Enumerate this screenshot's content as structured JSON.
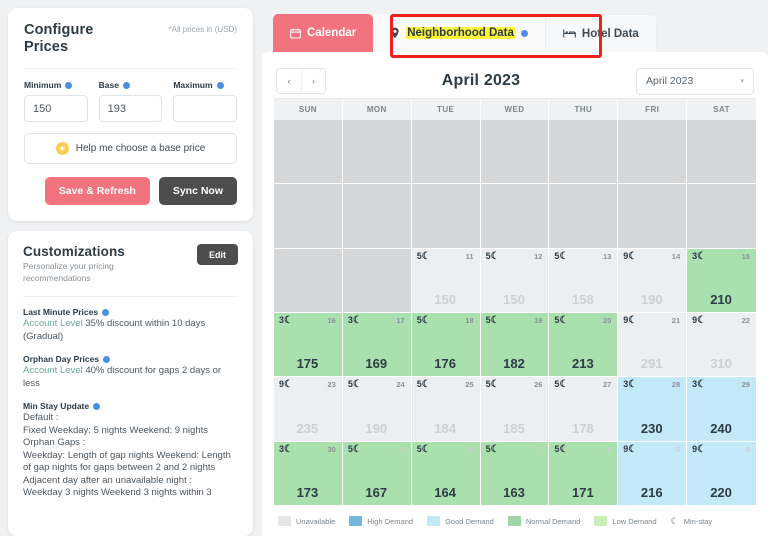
{
  "sidebar": {
    "configure": {
      "title": "Configure Prices",
      "note": "*All prices in (USD)",
      "minimum_label": "Minimum",
      "minimum_value": "150",
      "base_label": "Base",
      "base_value": "193",
      "maximum_label": "Maximum",
      "maximum_value": "",
      "maximum_placeholder": "",
      "help_label": "Help me choose a base price",
      "save_label": "Save & Refresh",
      "sync_label": "Sync Now"
    },
    "customizations": {
      "title": "Customizations",
      "subtitle": "Personalize your pricing recommendations",
      "edit_label": "Edit",
      "rules": [
        {
          "heading": "Last Minute Prices",
          "scope": "Account Level",
          "body": "35% discount within 10 days (Gradual)"
        },
        {
          "heading": "Orphan Day Prices",
          "scope": "Account Level",
          "body": "40% discount for gaps 2 days or less"
        }
      ],
      "min_stay": {
        "heading": "Min Stay Update",
        "default_label": "Default :",
        "default_value": "Fixed Weekday: 5 nights Weekend: 9 nights",
        "orphan_label": "Orphan Gaps :",
        "orphan_value": "Weekday: Length of gap nights Weekend: Length of gap nights for gaps between 2 and 2 nights",
        "adjacent_label": "Adjacent day after an unavailable night :",
        "adjacent_value": "Weekday 3 nights Weekend 3 nights within 3"
      }
    }
  },
  "tabs": [
    {
      "label": "Calendar",
      "icon": "calendar-icon",
      "state": "active"
    },
    {
      "label": "Neighborhood Data",
      "icon": "location-pin-icon",
      "state": "highlighted",
      "dot": true
    },
    {
      "label": "Hotel Data",
      "icon": "bed-icon",
      "state": "default"
    }
  ],
  "calendar": {
    "prev_label": "‹",
    "next_label": "›",
    "title": "April 2023",
    "month_select_value": "April 2023",
    "caret": "▾",
    "day_headers": [
      "SUN",
      "MON",
      "TUE",
      "WED",
      "THU",
      "FRI",
      "SAT"
    ],
    "moon_glyph": "☾",
    "weeks": [
      [
        {
          "kind": "unavailable"
        },
        {
          "kind": "unavailable"
        },
        {
          "kind": "unavailable"
        },
        {
          "kind": "unavailable"
        },
        {
          "kind": "unavailable"
        },
        {
          "kind": "unavailable"
        },
        {
          "kind": "unavailable"
        }
      ],
      [
        {
          "kind": "unavailable"
        },
        {
          "kind": "unavailable"
        },
        {
          "kind": "unavailable"
        },
        {
          "kind": "unavailable"
        },
        {
          "kind": "unavailable"
        },
        {
          "kind": "unavailable"
        },
        {
          "kind": "unavailable"
        }
      ],
      [
        {
          "kind": "unavailable"
        },
        {
          "kind": "unavailable"
        },
        {
          "kind": "blank",
          "day": "11",
          "minstay": "5",
          "price": "150",
          "dim": true
        },
        {
          "kind": "blank",
          "day": "12",
          "minstay": "5",
          "price": "150",
          "dim": true
        },
        {
          "kind": "blank",
          "day": "13",
          "minstay": "5",
          "price": "158",
          "dim": true
        },
        {
          "kind": "blank",
          "day": "14",
          "minstay": "9",
          "price": "190",
          "dim": true
        },
        {
          "kind": "low",
          "day": "15",
          "minstay": "3",
          "price": "210",
          "dim": false
        }
      ],
      [
        {
          "kind": "low",
          "day": "16",
          "minstay": "3",
          "price": "175",
          "dim": false
        },
        {
          "kind": "low",
          "day": "17",
          "minstay": "3",
          "price": "169",
          "dim": false
        },
        {
          "kind": "low",
          "day": "18",
          "minstay": "5",
          "price": "176",
          "dim": false
        },
        {
          "kind": "low",
          "day": "19",
          "minstay": "5",
          "price": "182",
          "dim": false
        },
        {
          "kind": "low",
          "day": "20",
          "minstay": "5",
          "price": "213",
          "dim": false
        },
        {
          "kind": "blank",
          "day": "21",
          "minstay": "9",
          "price": "291",
          "dim": true
        },
        {
          "kind": "blank",
          "day": "22",
          "minstay": "9",
          "price": "310",
          "dim": true
        }
      ],
      [
        {
          "kind": "blank",
          "day": "23",
          "minstay": "9",
          "price": "235",
          "dim": true
        },
        {
          "kind": "blank",
          "day": "24",
          "minstay": "5",
          "price": "190",
          "dim": true
        },
        {
          "kind": "blank",
          "day": "25",
          "minstay": "5",
          "price": "184",
          "dim": true
        },
        {
          "kind": "blank",
          "day": "26",
          "minstay": "5",
          "price": "185",
          "dim": true
        },
        {
          "kind": "blank",
          "day": "27",
          "minstay": "5",
          "price": "178",
          "dim": true
        },
        {
          "kind": "good",
          "day": "28",
          "minstay": "3",
          "price": "230",
          "dim": false
        },
        {
          "kind": "good",
          "day": "29",
          "minstay": "3",
          "price": "240",
          "dim": false
        }
      ],
      [
        {
          "kind": "low",
          "day": "30",
          "minstay": "3",
          "price": "173",
          "dim": false
        },
        {
          "kind": "low",
          "day": "1",
          "minstay": "5",
          "price": "167",
          "dim": false,
          "daydim": true
        },
        {
          "kind": "low",
          "day": "2",
          "minstay": "5",
          "price": "164",
          "dim": false,
          "daydim": true
        },
        {
          "kind": "low",
          "day": "3",
          "minstay": "5",
          "price": "163",
          "dim": false,
          "daydim": true
        },
        {
          "kind": "low",
          "day": "4",
          "minstay": "5",
          "price": "171",
          "dim": false,
          "daydim": true
        },
        {
          "kind": "good",
          "day": "5",
          "minstay": "9",
          "price": "216",
          "dim": false,
          "daydim": true
        },
        {
          "kind": "good",
          "day": "6",
          "minstay": "9",
          "price": "220",
          "dim": false,
          "daydim": true
        }
      ]
    ],
    "legend": [
      {
        "label": "Unavailable",
        "color": "#e4e6e7"
      },
      {
        "label": "High Demand",
        "color": "#74b9dd"
      },
      {
        "label": "Good Demand",
        "color": "#c3e8f7"
      },
      {
        "label": "Normal Demand",
        "color": "#9fd4a6"
      },
      {
        "label": "Low Demand",
        "color": "#c9eeb7"
      },
      {
        "label": "Min-stay",
        "color": "moon"
      }
    ]
  },
  "colors": {
    "accent_pink": "#f0737d",
    "highlight_yellow": "#fbf33c",
    "redbox": "#ef2119",
    "info_blue": "#4a90e2"
  }
}
